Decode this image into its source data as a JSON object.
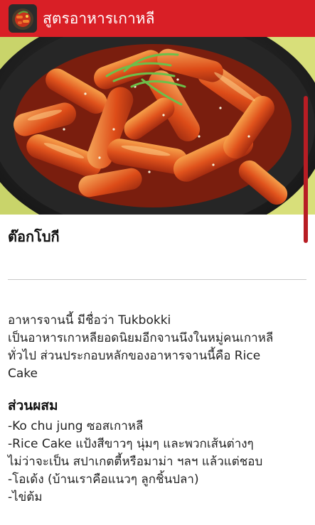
{
  "app_bar": {
    "title": "สูตรอาหารเกาหลี",
    "icon": "dish-thumbnail-icon",
    "color": "#d91f26"
  },
  "hero": {
    "icon": "tteokbokki-photo"
  },
  "recipe": {
    "title": "ต๊อกโบกี",
    "description_lines": [
      "อาหารจานนี้ มีชื่อว่า Tukbokki",
      "เป็นอาหารเกาหลียอดนิยมอีกจานนึงในหมู่คนเกาหลี",
      "ทั่วไป ส่วนประกอบหลักของอาหารจานนี้คือ Rice",
      "Cake"
    ],
    "ingredients_heading": "ส่วนผสม",
    "ingredients": [
      "-Ko chu jung ซอสเกาหลี",
      "-Rice Cake แป้งสีขาวๆ นุ่มๆ และพวกเส้นต่างๆ",
      "ไม่ว่าจะเป็น สปาเกตตี้หรือมาม่า ฯลฯ แล้วแต่ชอบ",
      "-โอเด้ง (บ้านเราคือแนวๆ ลูกชิ้นปลา)",
      "-ไข่ต้ม"
    ]
  }
}
